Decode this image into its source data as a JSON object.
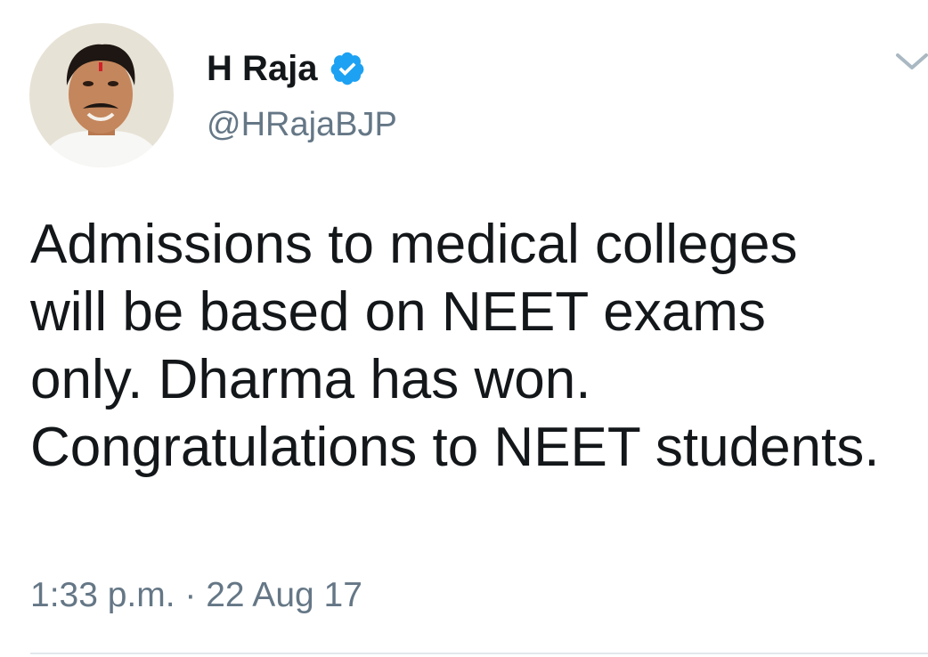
{
  "tweet": {
    "author": {
      "display_name": "H Raja",
      "handle": "@HRajaBJP",
      "verified": true,
      "avatar_icon": "profile-photo"
    },
    "text": "Admissions to medical colleges will be based on NEET exams only. Dharma has won. Congratulations to NEET students.",
    "timestamp": "1:33 p.m. · 22 Aug 17",
    "menu_icon": "chevron-down-icon"
  },
  "colors": {
    "primary_text": "#14171a",
    "secondary_text": "#657786",
    "verified_badge": "#1da1f2",
    "divider": "#e1e8ed"
  }
}
